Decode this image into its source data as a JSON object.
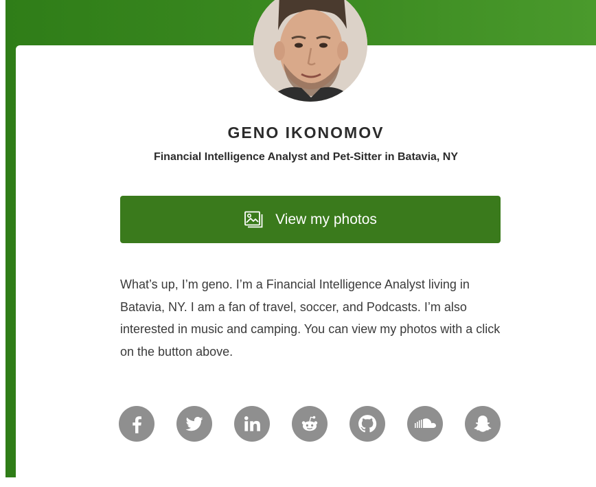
{
  "profile": {
    "name": "GENO IKONOMOV",
    "subtitle": "Financial Intelligence Analyst and Pet-Sitter in Batavia, NY",
    "avatar_icon": "avatar"
  },
  "cta": {
    "label": "View my photos",
    "icon": "photos-icon"
  },
  "bio": "What’s up, I’m geno. I’m a Financial Intelligence Analyst living in Batavia, NY. I am a fan of travel, soccer, and Podcasts. I’m also interested in music and camping. You can view my photos with a click on the button above.",
  "socials": [
    {
      "icon": "facebook-icon"
    },
    {
      "icon": "twitter-icon"
    },
    {
      "icon": "linkedin-icon"
    },
    {
      "icon": "reddit-icon"
    },
    {
      "icon": "github-icon"
    },
    {
      "icon": "soundcloud-icon"
    },
    {
      "icon": "snapchat-icon"
    }
  ],
  "colors": {
    "brand_green": "#3a7a1c",
    "banner_green": "#3d8c22",
    "icon_gray": "#8f8f8f",
    "text_dark": "#2b2b2b"
  }
}
